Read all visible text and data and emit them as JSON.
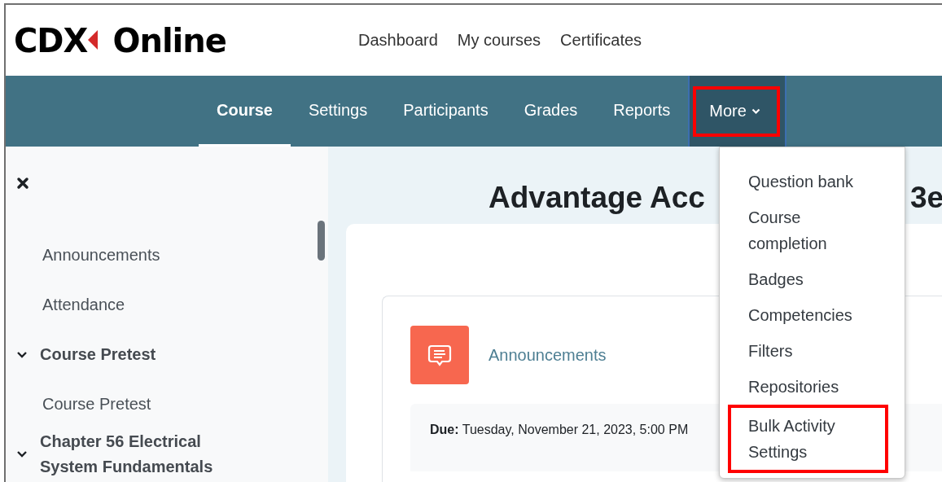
{
  "header": {
    "logo": {
      "mark": "CDX",
      "name": "Online"
    },
    "links": [
      {
        "label": "Dashboard"
      },
      {
        "label": "My courses"
      },
      {
        "label": "Certificates"
      }
    ]
  },
  "tabs": [
    {
      "label": "Course",
      "selected": true,
      "highlighted": false,
      "dropdown": false
    },
    {
      "label": "Settings",
      "selected": false,
      "highlighted": false,
      "dropdown": false
    },
    {
      "label": "Participants",
      "selected": false,
      "highlighted": false,
      "dropdown": false
    },
    {
      "label": "Grades",
      "selected": false,
      "highlighted": false,
      "dropdown": false
    },
    {
      "label": "Reports",
      "selected": false,
      "highlighted": false,
      "dropdown": false
    },
    {
      "label": "More",
      "selected": false,
      "highlighted": true,
      "dropdown": true
    }
  ],
  "more_menu": [
    {
      "label": "Question bank",
      "highlighted": false
    },
    {
      "label": "Course completion",
      "highlighted": false
    },
    {
      "label": "Badges",
      "highlighted": false
    },
    {
      "label": "Competencies",
      "highlighted": false
    },
    {
      "label": "Filters",
      "highlighted": false
    },
    {
      "label": "Repositories",
      "highlighted": false
    },
    {
      "label": "Bulk Activity Settings",
      "highlighted": true
    }
  ],
  "sidebar": {
    "items": [
      {
        "kind": "activity",
        "label": "Announcements"
      },
      {
        "kind": "activity",
        "label": "Attendance"
      },
      {
        "kind": "section",
        "label": "Course Pretest",
        "expanded": true,
        "children": [
          {
            "kind": "activity",
            "label": "Course Pretest"
          }
        ]
      },
      {
        "kind": "section",
        "label": "Chapter 56 Electrical System Fundamentals",
        "expanded": true
      }
    ]
  },
  "course": {
    "title": "Advantage Acc",
    "title_end": "3e",
    "activity": {
      "name": "Announcements",
      "due": "**Due:** Tuesday, November 21, 2023, 5:00 PM"
    }
  }
}
